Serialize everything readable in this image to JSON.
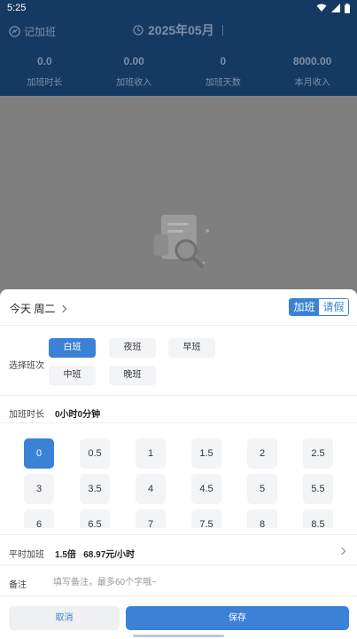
{
  "status_bar": {
    "time": "5:25",
    "icons": [
      "wifi-icon",
      "signal-icon",
      "battery-icon"
    ]
  },
  "header": {
    "left_label": "记加班",
    "month_title": "2025年05月"
  },
  "stats": [
    {
      "value": "0.0",
      "label": "加班时长"
    },
    {
      "value": "0.00",
      "label": "加班收入"
    },
    {
      "value": "0",
      "label": "加班天数"
    },
    {
      "value": "8000.00",
      "label": "本月收入"
    }
  ],
  "sheet": {
    "date_title": "今天 周二",
    "mode_tabs": [
      {
        "label": "加班",
        "active": true
      },
      {
        "label": "请假",
        "active": false
      }
    ],
    "shift": {
      "label": "选择班次",
      "options": [
        {
          "label": "白班",
          "active": true
        },
        {
          "label": "夜班",
          "active": false
        },
        {
          "label": "早班",
          "active": false
        },
        {
          "label": "中班",
          "active": false
        },
        {
          "label": "晚班",
          "active": false
        }
      ]
    },
    "duration": {
      "label": "加班时长",
      "value": "0小时0分钟",
      "options": [
        "0",
        "0.5",
        "1",
        "1.5",
        "2",
        "2.5",
        "3",
        "3.5",
        "4",
        "4.5",
        "5",
        "5.5",
        "6",
        "6.5",
        "7",
        "7.5",
        "8",
        "8.5"
      ],
      "selected": "0"
    },
    "rate": {
      "label": "平时加班",
      "value": "1.5倍   68.97元/小时"
    },
    "note": {
      "label": "备注",
      "placeholder": "填写备注，最多60个字哦~"
    },
    "actions": {
      "cancel": "取消",
      "save": "保存"
    }
  },
  "colors": {
    "primary": "#3b82d6",
    "header_bg": "#143a62",
    "overlay": "#7f7f7f"
  }
}
